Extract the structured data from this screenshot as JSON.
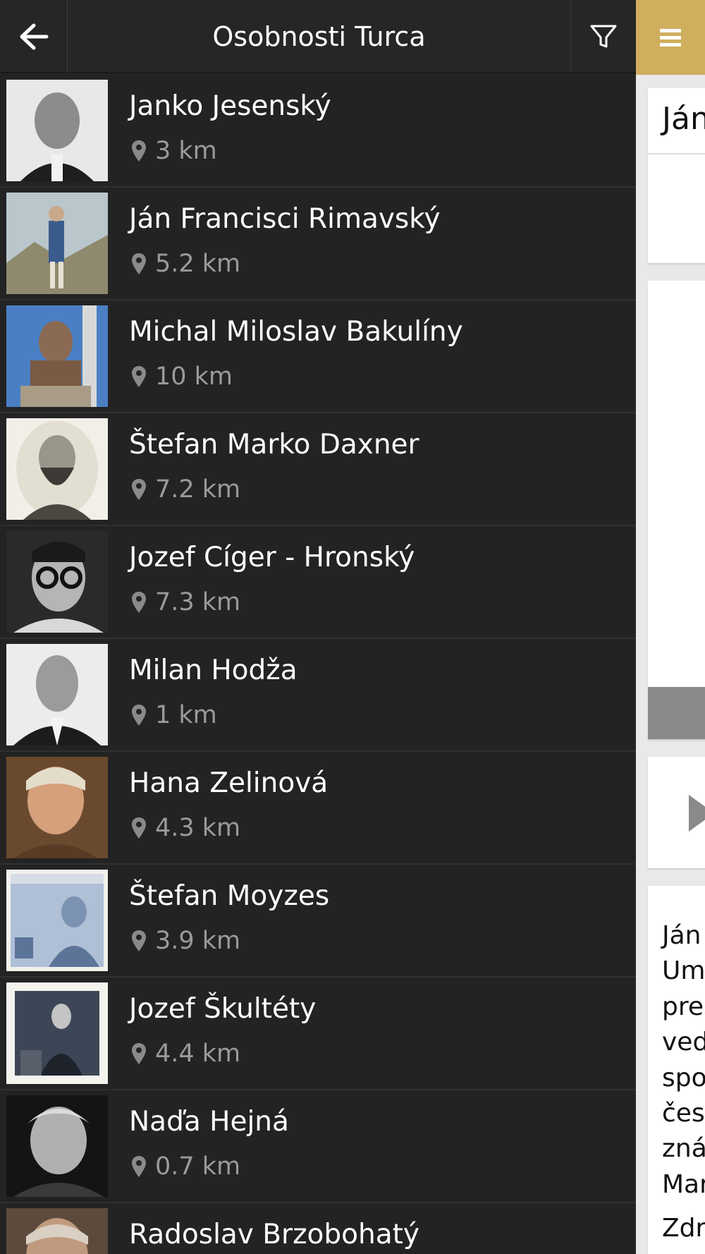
{
  "header": {
    "title": "Osobnosti Turca",
    "back_icon": "arrow-left-icon",
    "filter_icon": "filter-funnel-icon",
    "menu_icon": "hamburger-menu-icon"
  },
  "colors": {
    "list_background": "#232323",
    "accent": "#cfae5d",
    "name_text": "#ffffff",
    "distance_text": "#9a9a9a"
  },
  "people": [
    {
      "name": "Janko Jesenský",
      "distance": "3 km"
    },
    {
      "name": "Ján Francisci Rimavský",
      "distance": "5.2 km"
    },
    {
      "name": "Michal Miloslav Bakulíny",
      "distance": "10 km"
    },
    {
      "name": "Štefan Marko Daxner",
      "distance": "7.2 km"
    },
    {
      "name": "Jozef Cíger - Hronský",
      "distance": "7.3 km"
    },
    {
      "name": "Milan Hodža",
      "distance": "1 km"
    },
    {
      "name": "Hana Zelinová",
      "distance": "4.3 km"
    },
    {
      "name": "Štefan Moyzes",
      "distance": "3.9 km"
    },
    {
      "name": "Jozef Škultéty",
      "distance": "4.4 km"
    },
    {
      "name": "Naďa Hejná",
      "distance": "0.7 km"
    },
    {
      "name": "Radoslav Brzobohatý",
      "distance": ""
    }
  ],
  "detail": {
    "title_fragment": "Ján",
    "text_fragments": [
      "Ján",
      "Umr",
      "preš",
      "vedo",
      "spo",
      "čest",
      "znár",
      "Mar"
    ],
    "source_fragment": "Zdro"
  }
}
